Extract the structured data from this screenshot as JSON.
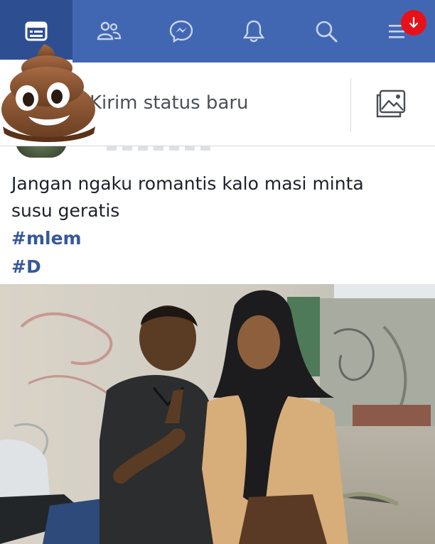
{
  "topbar": {
    "tabs": [
      {
        "icon": "news-feed-icon",
        "active": true
      },
      {
        "icon": "friends-icon",
        "active": false
      },
      {
        "icon": "messenger-icon",
        "active": false
      },
      {
        "icon": "bell-icon",
        "active": false
      },
      {
        "icon": "search-icon",
        "active": false
      },
      {
        "icon": "menu-icon",
        "active": false
      }
    ],
    "download_badge_icon": "down-arrow-icon",
    "colors": {
      "bar": "#4267b2",
      "active": "#2d4f92",
      "badge": "#e8111a"
    }
  },
  "composer": {
    "placeholder": "Kirim status baru",
    "photo_icon": "photo-icon",
    "avatar_sticker": "pile-of-poo-emoji"
  },
  "post": {
    "text_line_1": "Jangan ngaku romantis kalo masi minta",
    "text_line_2": "susu geratis",
    "hashtags": [
      "#mlem",
      "#D"
    ],
    "photo": "photo of two teenagers in front of a graffiti wall",
    "colors": {
      "hashtag": "#365899",
      "text": "#1d2129"
    }
  }
}
